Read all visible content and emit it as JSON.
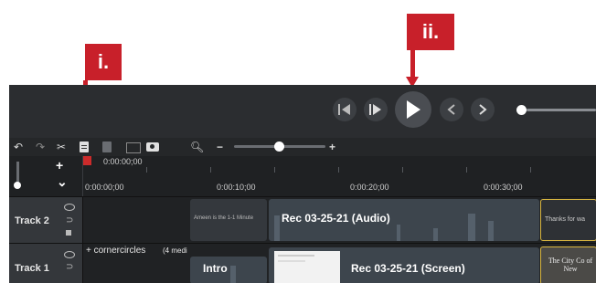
{
  "callouts": {
    "first": "i.",
    "second": "ii."
  },
  "toolbar": {
    "undo_icon": "undo-icon",
    "redo_icon": "redo-icon",
    "cut_icon": "cut-icon",
    "paste_icon": "paste-icon",
    "split_icon": "split-icon",
    "snapshot_icon": "camera-icon",
    "zoom_icon": "zoom-icon",
    "zoom_out": "−",
    "zoom_in": "+"
  },
  "timeline": {
    "playhead_time": "0:00:00;00",
    "ruler_labels": [
      "0:00:00;00",
      "0:00:10;00",
      "0:00:20;00",
      "0:00:30;00"
    ],
    "add_track": "+",
    "collapse": "⌄"
  },
  "tracks": [
    {
      "name": "Track 2",
      "clips": [
        {
          "title": "Ameen is the 1-1 Minute",
          "kind": "title-card"
        },
        {
          "title": "Rec 03-25-21 (Audio)",
          "kind": "audio"
        },
        {
          "title": "Thanks for wa",
          "kind": "title-card"
        }
      ]
    },
    {
      "name": "Track 1",
      "group_label": "+  cornercircles",
      "group_count": "(4 medi",
      "clips": [
        {
          "title": "Intro",
          "kind": "video"
        },
        {
          "title": "Rec 03-25-21 (Screen)",
          "kind": "screen"
        },
        {
          "title": "The City Co of New",
          "kind": "title-card"
        }
      ]
    }
  ],
  "colors": {
    "accent": "#c8202a",
    "background": "#2b2d30",
    "selected_clip_border": "#d9b640"
  }
}
